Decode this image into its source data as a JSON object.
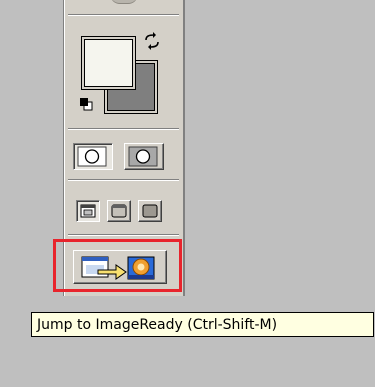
{
  "palette": {
    "foreground_color": "#f5f5ee",
    "background_color": "#7f7f7f",
    "icons": {
      "swap_colors": "swap-colors-icon",
      "default_colors": "default-colors-icon",
      "standard_mode": "standard-mode-icon",
      "quick_mask_mode": "quick-mask-mode-icon",
      "standard_screen": "standard-screen-mode-icon",
      "full_screen_menu": "full-screen-menu-icon",
      "full_screen": "full-screen-mode-icon",
      "jump_to_imageready": "jump-to-imageready-icon"
    }
  },
  "highlight_color": "#e8242c",
  "tooltip": {
    "text": "Jump to ImageReady (Ctrl-Shift-M)"
  }
}
